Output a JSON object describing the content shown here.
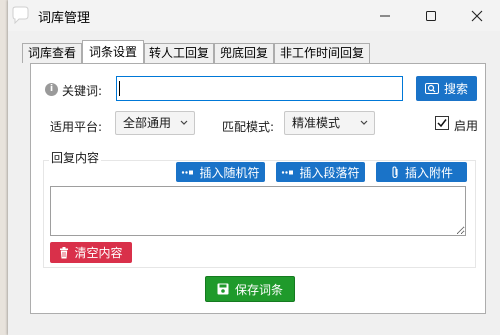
{
  "window": {
    "title": "词库管理"
  },
  "tabs": [
    {
      "label": "词库查看",
      "active": false
    },
    {
      "label": "词条设置",
      "active": true
    },
    {
      "label": "转人工回复",
      "active": false
    },
    {
      "label": "兜底回复",
      "active": false
    },
    {
      "label": "非工作时间回复",
      "active": false
    }
  ],
  "form": {
    "keyword_label": "关键词:",
    "keyword_value": "",
    "search_button": "搜索",
    "platform_label": "适用平台:",
    "platform_selected": "全部通用",
    "match_label": "匹配模式:",
    "match_selected": "精准模式",
    "enable_label": "启用",
    "enable_checked": true
  },
  "reply": {
    "group_title": "回复内容",
    "insert_random_button": "插入随机符",
    "insert_paragraph_button": "插入段落符",
    "insert_attachment_button": "插入附件",
    "content": "",
    "clear_button": "清空内容"
  },
  "save_button": "保存词条",
  "colors": {
    "primary_blue": "#1a73c8",
    "danger_red": "#d9304a",
    "success_green": "#1f9a2b",
    "input_focus": "#0078d7"
  },
  "icons": {
    "app": "chat-bubble-icon",
    "info": "info-icon",
    "search": "search-icon",
    "random": "dots-insert-icon",
    "paragraph": "dots-insert-icon",
    "attachment": "paperclip-icon",
    "clear": "trash-icon",
    "save": "save-icon"
  }
}
